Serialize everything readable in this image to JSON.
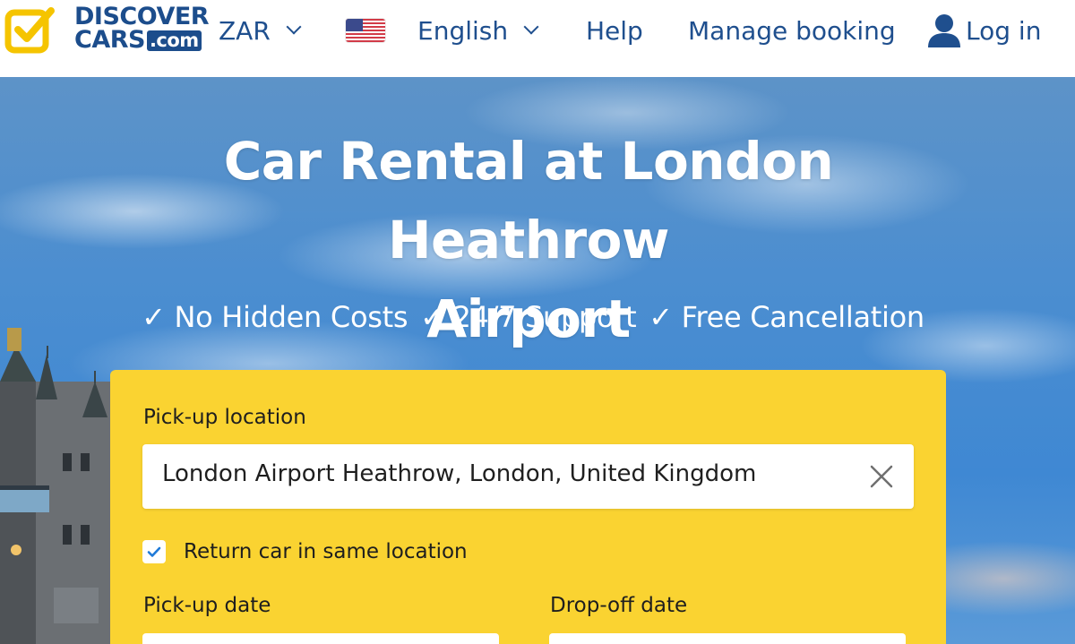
{
  "header": {
    "logo": {
      "line1": "DISCOVER",
      "line2": "CARS",
      "suffix": ".com",
      "icon": "check-square-icon",
      "colors": {
        "mark": "#f5c400",
        "text": "#1c4d8c"
      }
    },
    "currency": {
      "label": "ZAR",
      "icon": "chevron-down-icon"
    },
    "language": {
      "label": "English",
      "flag": "us-flag-icon",
      "icon": "chevron-down-icon"
    },
    "help": "Help",
    "manage_booking": "Manage booking",
    "login": {
      "label": "Log in",
      "icon": "user-icon"
    },
    "link_color": "#1f4f8e"
  },
  "hero": {
    "title_line1": "Car Rental at London Heathrow",
    "title_line2": "Airport",
    "benefits": [
      "✓ No Hidden Costs",
      "✓ 24/7 Support",
      "✓ Free Cancellation"
    ]
  },
  "search_form": {
    "background": "#fad331",
    "pickup_location_label": "Pick-up location",
    "pickup_location_value": "London Airport Heathrow, London, United Kingdom",
    "clear_icon": "close-icon",
    "return_same_location": {
      "label": "Return car in same location",
      "checked": true
    },
    "pickup_date_label": "Pick-up date",
    "dropoff_date_label": "Drop-off date"
  }
}
